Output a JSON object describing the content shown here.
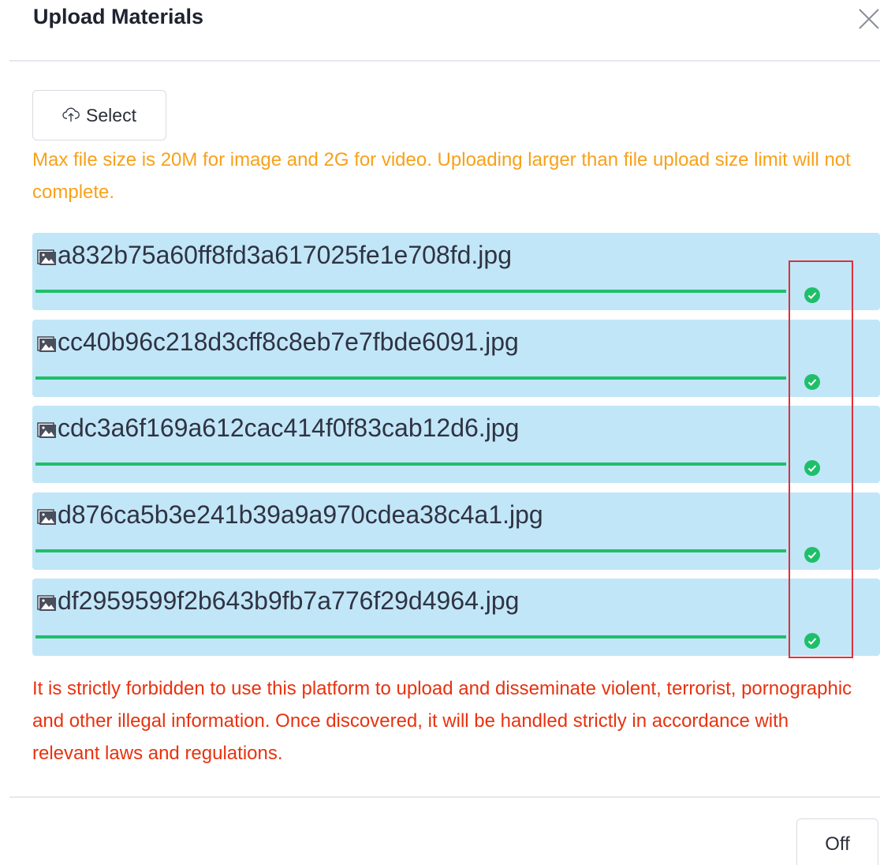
{
  "dialog": {
    "title": "Upload Materials",
    "close_icon": "close-icon"
  },
  "select_button": {
    "icon": "cloud-upload-icon",
    "label": "Select"
  },
  "size_note": "Max file size is 20M for image and 2G for video. Uploading larger than file upload size limit will not complete.",
  "files": [
    {
      "name": "a832b75a60ff8fd3a617025fe1e708fd.jpg",
      "progress": 1.0,
      "status_icon": "check-circle-icon"
    },
    {
      "name": "cc40b96c218d3cff8c8eb7e7fbde6091.jpg",
      "progress": 1.0,
      "status_icon": "check-circle-icon"
    },
    {
      "name": "cdc3a6f169a612cac414f0f83cab12d6.jpg",
      "progress": 1.0,
      "status_icon": "check-circle-icon"
    },
    {
      "name": "d876ca5b3e241b39a9a970cdea38c4a1.jpg",
      "progress": 1.0,
      "status_icon": "check-circle-icon"
    },
    {
      "name": "df2959599f2b643b9fb7a776f29d4964.jpg",
      "progress": 1.0,
      "status_icon": "check-circle-icon"
    }
  ],
  "warning": "It is strictly forbidden to use this platform to upload and disseminate violent, terrorist, pornographic and other illegal information. Once discovered, it will be handled strictly in accordance with relevant laws and regulations.",
  "footer": {
    "off_label": "Off"
  },
  "colors": {
    "note": "#f7a11a",
    "warning": "#e8320f",
    "file_bg": "#c1e6f8",
    "progress": "#1fbf6a",
    "highlight": "#e0303a"
  }
}
